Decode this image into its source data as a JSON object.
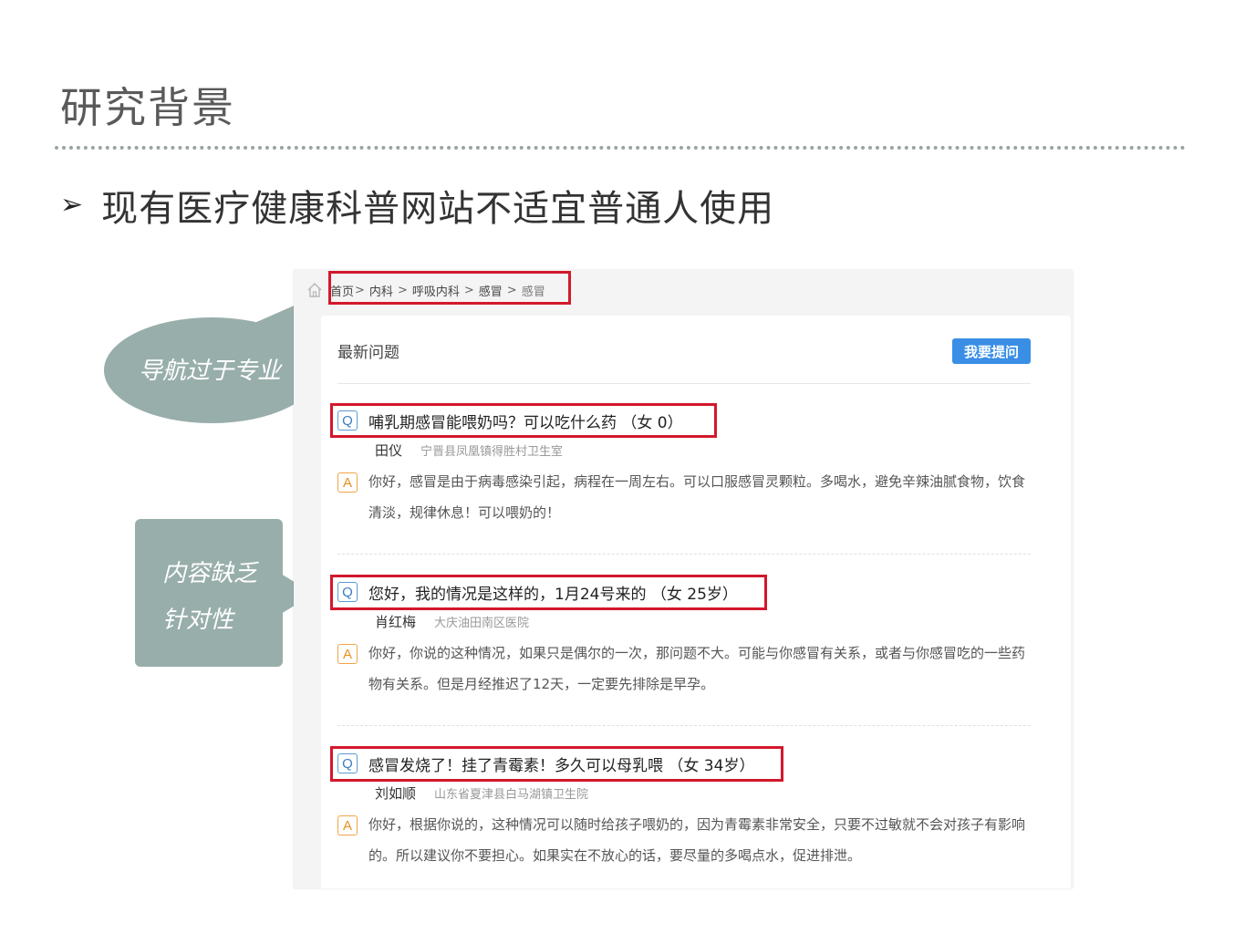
{
  "slide": {
    "title": "研究背景",
    "bullet": "现有医疗健康科普网站不适宜普通人使用"
  },
  "callouts": {
    "nav": "导航过于专业",
    "content_line1": "内容缺乏",
    "content_line2": "针对性"
  },
  "site": {
    "breadcrumb": {
      "home": "首页",
      "items": [
        "内科",
        "呼吸内科",
        "感冒"
      ],
      "current": "感冒"
    },
    "section_title": "最新问题",
    "ask_button": "我要提问",
    "questions": [
      {
        "question": "哺乳期感冒能喂奶吗？可以吃什么药 （女 0）",
        "doctor": "田仪",
        "hospital": "宁晋县凤凰镇得胜村卫生室",
        "answer": "你好，感冒是由于病毒感染引起，病程在一周左右。可以口服感冒灵颗粒。多喝水，避免辛辣油腻食物，饮食清淡，规律休息！可以喂奶的！"
      },
      {
        "question": "您好，我的情况是这样的，1月24号来的 （女 25岁）",
        "doctor": "肖红梅",
        "hospital": "大庆油田南区医院",
        "answer": "你好，你说的这种情况，如果只是偶尔的一次，那问题不大。可能与你感冒有关系，或者与你感冒吃的一些药物有关系。但是月经推迟了12天，一定要先排除是早孕。"
      },
      {
        "question": "感冒发烧了！挂了青霉素！多久可以母乳喂 （女 34岁）",
        "doctor": "刘如顺",
        "hospital": "山东省夏津县白马湖镇卫生院",
        "answer": "你好，根据你说的，这种情况可以随时给孩子喂奶的，因为青霉素非常安全，只要不过敏就不会对孩子有影响的。所以建议你不要担心。如果实在不放心的话，要尽量的多喝点水，促进排泄。"
      }
    ],
    "badges": {
      "q": "Q",
      "a": "A"
    }
  },
  "icons": {
    "bullet": "arrowhead-bullet-icon",
    "home": "home-icon"
  },
  "colors": {
    "highlight": "#d3182c",
    "callout": "#98aeaa",
    "button": "#3a8ee6"
  }
}
